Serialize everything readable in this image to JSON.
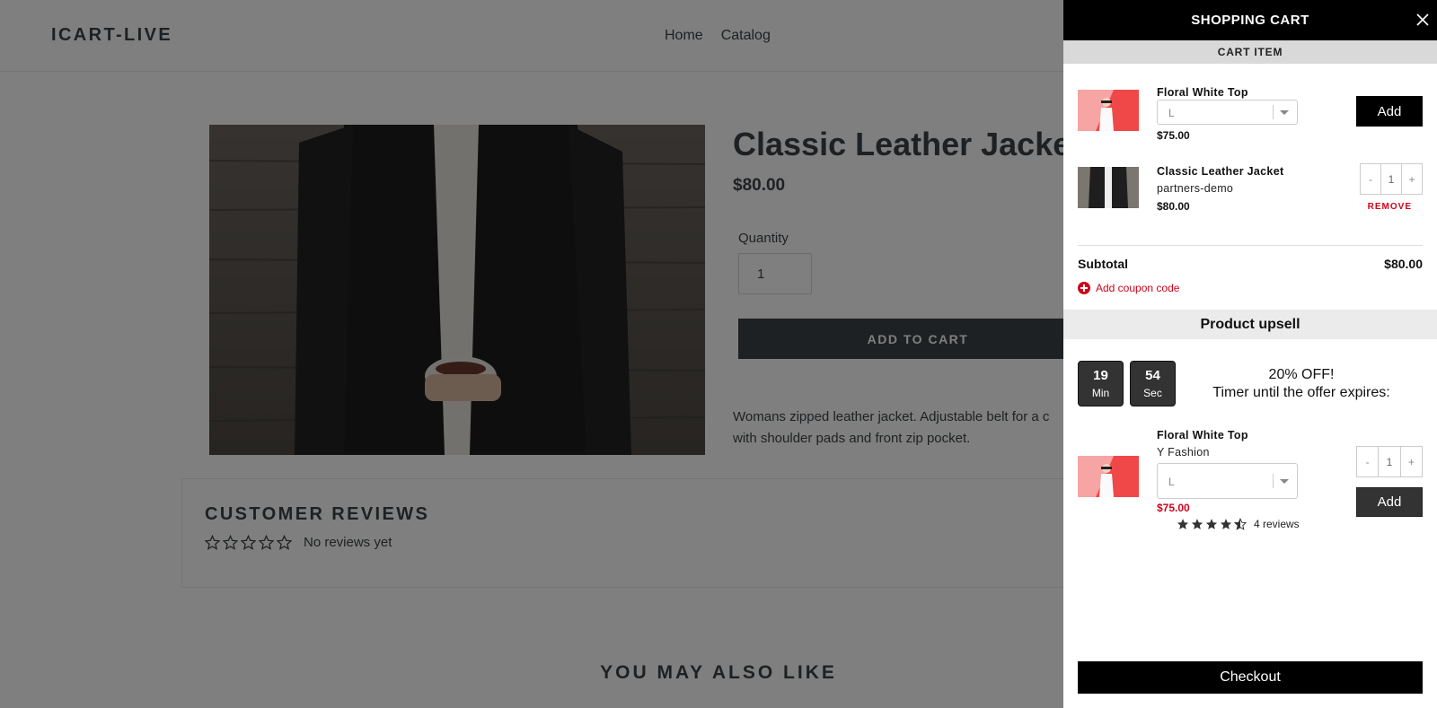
{
  "store": {
    "logo": "ICART-LIVE",
    "nav": [
      "Home",
      "Catalog"
    ],
    "product": {
      "title": "Classic Leather Jacket",
      "price": "$80.00",
      "quantity_label": "Quantity",
      "quantity_value": "1",
      "add_to_cart": "ADD TO CART",
      "description": "Womans zipped leather jacket. Adjustable belt for a c with shoulder pads and front zip pocket."
    },
    "reviews": {
      "title": "CUSTOMER REVIEWS",
      "empty_text": "No reviews yet"
    },
    "also_like": "YOU MAY ALSO LIKE"
  },
  "cart": {
    "title": "SHOPPING CART",
    "close_icon": "close-icon",
    "section_label": "CART ITEM",
    "items": [
      {
        "name": "Floral White Top",
        "variant": "L",
        "price": "$75.00",
        "action_label": "Add"
      },
      {
        "name": "Classic Leather Jacket",
        "vendor": "partners-demo",
        "price": "$80.00",
        "stepper": {
          "minus": "-",
          "value": "1",
          "plus": "+"
        },
        "remove_label": "REMOVE"
      }
    ],
    "subtotal_label": "Subtotal",
    "subtotal_value": "$80.00",
    "coupon_label": "Add coupon code",
    "upsell": {
      "title": "Product upsell",
      "timer": [
        {
          "value": "19",
          "unit": "Min"
        },
        {
          "value": "54",
          "unit": "Sec"
        }
      ],
      "offer_line1": "20% OFF!",
      "offer_line2": "Timer until the offer expires:",
      "product": {
        "name": "Floral White Top",
        "vendor": "Y Fashion",
        "variant": "L",
        "price": "$75.00",
        "stepper": {
          "minus": "-",
          "value": "1",
          "plus": "+"
        },
        "add_label": "Add",
        "rating": 4.5,
        "reviews_label": "4 reviews"
      }
    },
    "checkout_label": "Checkout"
  },
  "colors": {
    "accent_red": "#d0021b",
    "drawer_header": "#000000",
    "overlay": "rgba(0,0,0,0.5)"
  }
}
